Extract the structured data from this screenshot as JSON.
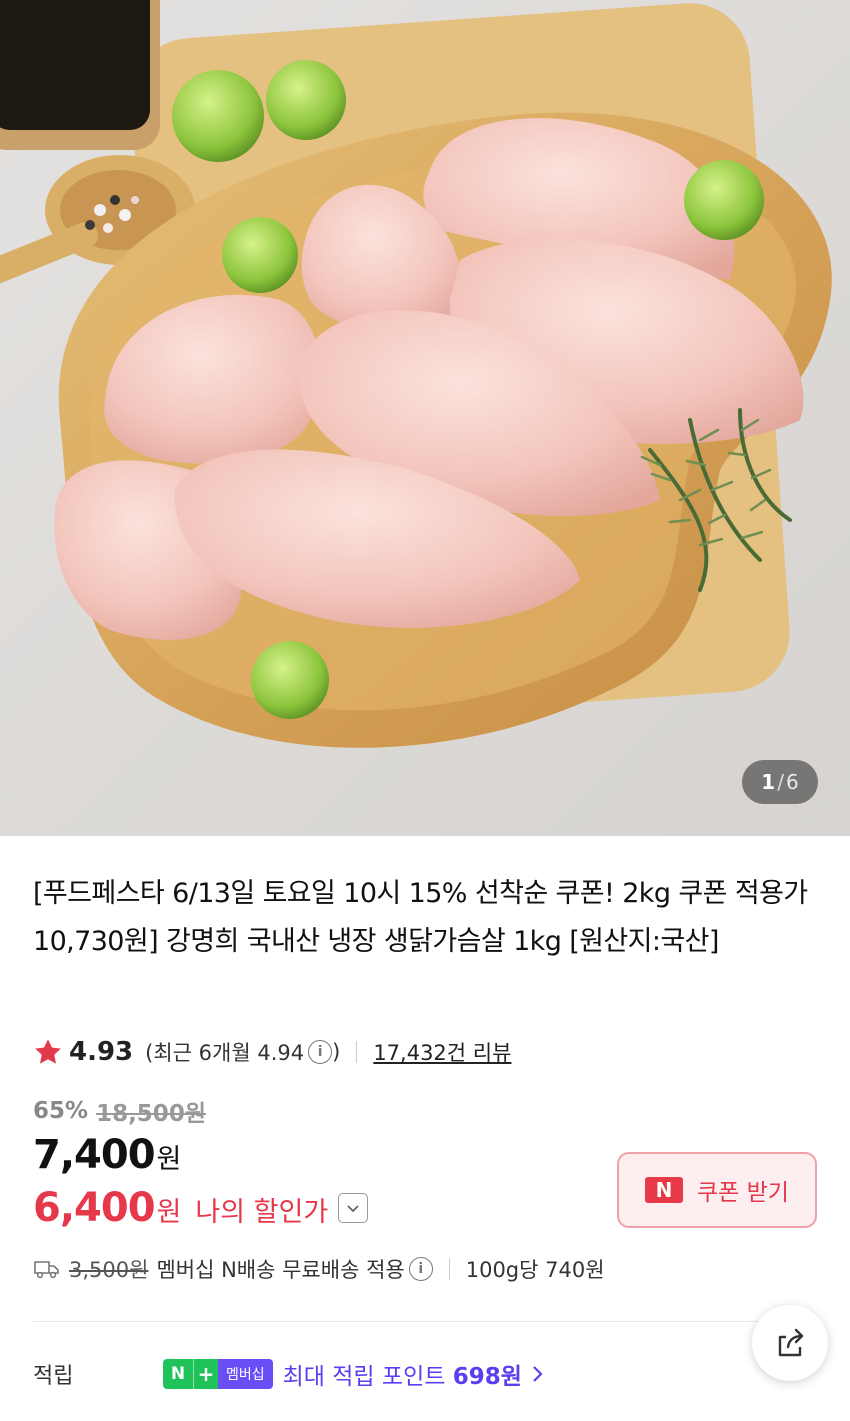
{
  "gallery": {
    "current": "1",
    "separator": "/",
    "total": "6"
  },
  "product": {
    "title": "[푸드페스타 6/13일 토요일 10시 15% 선착순 쿠폰! 2kg 쿠폰 적용가 10,730원] 강명희 국내산 냉장 생닭가슴살 1kg [원산지:국산]",
    "rating": "4.93",
    "recent_rating": "(최근 6개월 4.94",
    "recent_close": ")",
    "review_count": "17,432건 리뷰"
  },
  "pricing": {
    "discount_rate": "65%",
    "original_price": "18,500원",
    "price": "7,400",
    "price_unit": "원",
    "my_price": "6,400",
    "my_price_unit": "원",
    "my_price_label": "나의 할인가"
  },
  "coupon": {
    "badge": "N",
    "label": "쿠폰 받기"
  },
  "shipping": {
    "fee": "3,500원",
    "text": "멤버십 N배송 무료배송 적용",
    "unit_price": "100g당 740원"
  },
  "points": {
    "label": "적립",
    "badge_n": "N",
    "badge_plus": "+",
    "badge_member": "멤버십",
    "text": "최대 적립 포인트 ",
    "amount": "698원"
  },
  "icons": {
    "star": "star-icon",
    "info": "info-icon",
    "chevron": "chevron-down-icon",
    "truck": "truck-icon",
    "share": "share-icon"
  },
  "colors": {
    "accent_red": "#e5384a",
    "coupon_bg": "#fdeef0",
    "membership_green": "#1fc35a",
    "membership_purple": "#6a4df5"
  }
}
